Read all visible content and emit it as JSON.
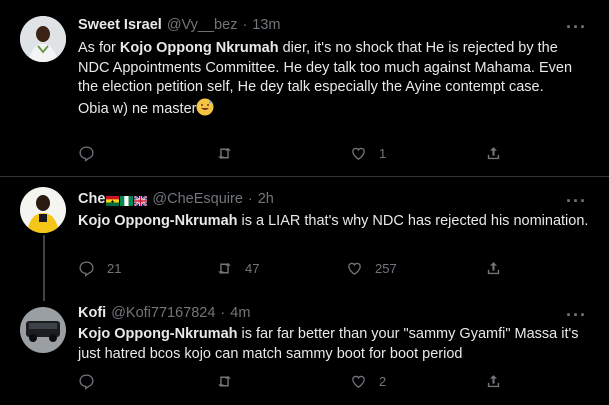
{
  "tweets": [
    {
      "name": "Sweet Israel",
      "handle": "@Vy__bez",
      "time": "13m",
      "body_bold": "Kojo Oppong Nkrumah",
      "body_pre": "As for ",
      "body_post": " dier, it's no shock that He is rejected by the NDC Appointments Committee. He dey talk too much against Mahama. Even the election petition self, He dey talk especially the Ayine contempt case.",
      "body_line2": "Obia w) ne master",
      "emoji": "sweat-smile-emoji",
      "replies": "",
      "retweets": "",
      "likes": "1"
    },
    {
      "name": "Che",
      "flags": [
        "ghana-flag",
        "nigeria-flag",
        "uk-flag"
      ],
      "handle": "@CheEsquire",
      "time": "2h",
      "body_bold": "Kojo Oppong-Nkrumah",
      "body_post": " is a LIAR that's why NDC has rejected his nomination.",
      "replies": "21",
      "retweets": "47",
      "likes": "257"
    },
    {
      "name": "Kofi",
      "handle": "@Kofi77167824",
      "time": "4m",
      "body_bold": "Kojo Oppong-Nkrumah",
      "body_post": " is far far better than your \"sammy Gyamfi\" Massa it's just hatred bcos kojo can match sammy boot for boot period",
      "replies": "",
      "retweets": "",
      "likes": "2"
    }
  ],
  "separator": "·",
  "more_label": "···"
}
